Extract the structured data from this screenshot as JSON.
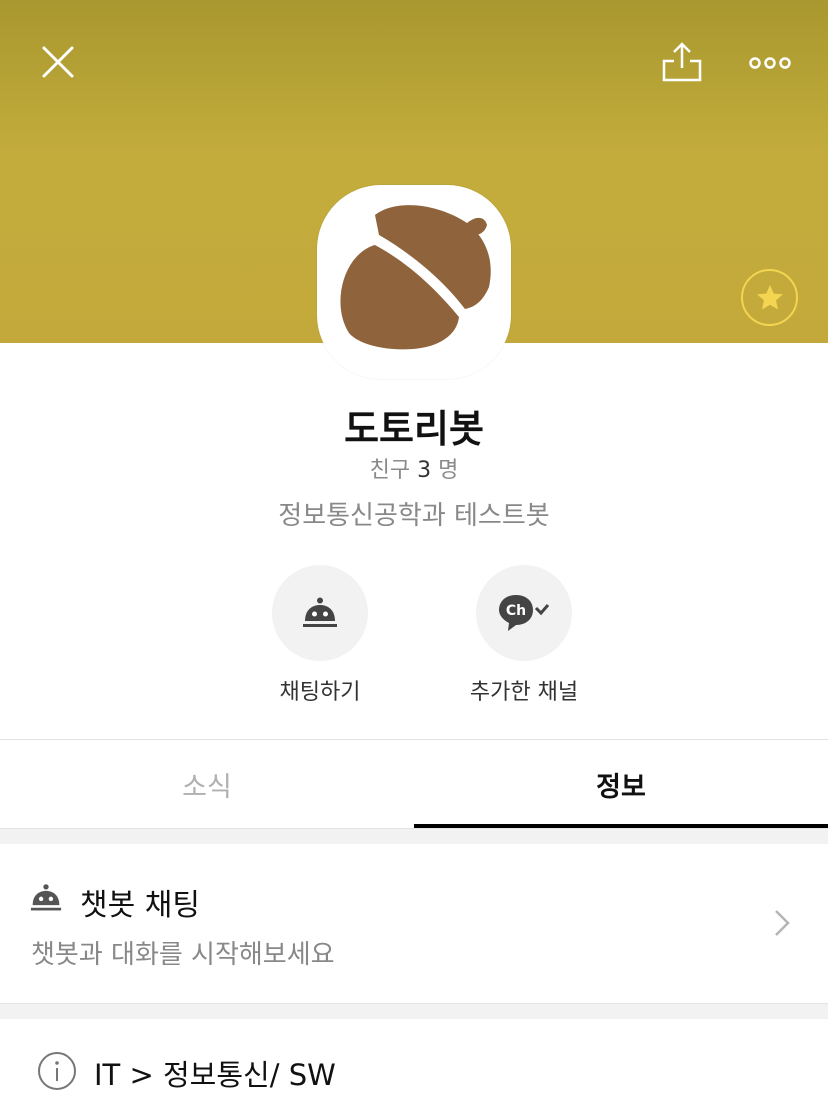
{
  "header": {
    "close_icon": "close-icon",
    "share_icon": "share-icon",
    "more_icon": "more-icon",
    "favorite_icon": "star-icon",
    "accent_color": "#f3d552"
  },
  "profile": {
    "image_icon": "acorn-icon",
    "name": "도토리봇",
    "friends_prefix": "친구",
    "friends_count": "3",
    "friends_suffix": "명",
    "description": "정보통신공학과 테스트봇"
  },
  "actions": [
    {
      "label": "채팅하기",
      "icon": "bot-icon"
    },
    {
      "label": "추가한 채널",
      "icon": "channel-added-icon"
    }
  ],
  "tabs": [
    {
      "label": "소식",
      "active": false
    },
    {
      "label": "정보",
      "active": true
    }
  ],
  "info": {
    "chatbot": {
      "title": "챗봇 채팅",
      "subtitle": "챗봇과 대화를 시작해보세요"
    },
    "category": "IT > 정보통신/ SW"
  }
}
